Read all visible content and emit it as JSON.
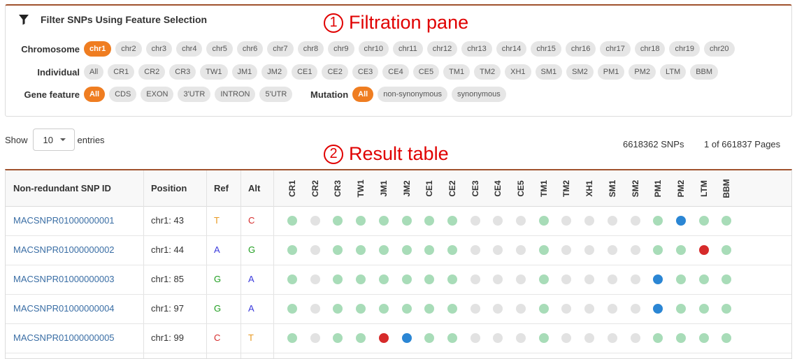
{
  "filter": {
    "title": "Filter SNPs Using Feature Selection",
    "chromosome": {
      "label": "Chromosome",
      "options": [
        "chr1",
        "chr2",
        "chr3",
        "chr4",
        "chr5",
        "chr6",
        "chr7",
        "chr8",
        "chr9",
        "chr10",
        "chr11",
        "chr12",
        "chr13",
        "chr14",
        "chr15",
        "chr16",
        "chr17",
        "chr18",
        "chr19",
        "chr20"
      ],
      "selected": "chr1"
    },
    "individual": {
      "label": "Individual",
      "options": [
        "All",
        "CR1",
        "CR2",
        "CR3",
        "TW1",
        "JM1",
        "JM2",
        "CE1",
        "CE2",
        "CE3",
        "CE4",
        "CE5",
        "TM1",
        "TM2",
        "XH1",
        "SM1",
        "SM2",
        "PM1",
        "PM2",
        "LTM",
        "BBM"
      ],
      "selected": null
    },
    "gene_feature": {
      "label": "Gene feature",
      "options": [
        "All",
        "CDS",
        "EXON",
        "3'UTR",
        "INTRON",
        "5'UTR"
      ],
      "selected": "All"
    },
    "mutation": {
      "label": "Mutation",
      "options": [
        "All",
        "non-synonymous",
        "synonymous"
      ],
      "selected": "All"
    }
  },
  "annotations": {
    "filtration": {
      "number": "1",
      "text": "Filtration pane"
    },
    "result": {
      "number": "2",
      "text": "Result table"
    }
  },
  "entries": {
    "show_label": "Show",
    "value": "10",
    "suffix": "entries"
  },
  "stats": {
    "snps": "6618362 SNPs",
    "pages": "1 of 661837 Pages"
  },
  "table": {
    "headers": {
      "id": "Non-redundant SNP ID",
      "position": "Position",
      "ref": "Ref",
      "alt": "Alt"
    },
    "individuals": [
      "CR1",
      "CR2",
      "CR3",
      "TW1",
      "JM1",
      "JM2",
      "CE1",
      "CE2",
      "CE3",
      "CE4",
      "CE5",
      "TM1",
      "TM2",
      "XH1",
      "SM1",
      "SM2",
      "PM1",
      "PM2",
      "LTM",
      "BBM"
    ],
    "rows": [
      {
        "id": "MACSNPR01000000001",
        "position": "chr1: 43",
        "ref": "T",
        "alt": "C",
        "genotypes": [
          "g",
          "x",
          "g",
          "g",
          "g",
          "g",
          "g",
          "g",
          "x",
          "x",
          "x",
          "g",
          "x",
          "x",
          "x",
          "x",
          "g",
          "b",
          "g",
          "g"
        ]
      },
      {
        "id": "MACSNPR01000000002",
        "position": "chr1: 44",
        "ref": "A",
        "alt": "G",
        "genotypes": [
          "g",
          "x",
          "g",
          "g",
          "g",
          "g",
          "g",
          "g",
          "x",
          "x",
          "x",
          "g",
          "x",
          "x",
          "x",
          "x",
          "g",
          "g",
          "r",
          "g"
        ]
      },
      {
        "id": "MACSNPR01000000003",
        "position": "chr1: 85",
        "ref": "G",
        "alt": "A",
        "genotypes": [
          "g",
          "x",
          "g",
          "g",
          "g",
          "g",
          "g",
          "g",
          "x",
          "x",
          "x",
          "g",
          "x",
          "x",
          "x",
          "x",
          "b",
          "g",
          "g",
          "g"
        ]
      },
      {
        "id": "MACSNPR01000000004",
        "position": "chr1: 97",
        "ref": "G",
        "alt": "A",
        "genotypes": [
          "g",
          "x",
          "g",
          "g",
          "g",
          "g",
          "g",
          "g",
          "x",
          "x",
          "x",
          "g",
          "x",
          "x",
          "x",
          "x",
          "b",
          "g",
          "g",
          "g"
        ]
      },
      {
        "id": "MACSNPR01000000005",
        "position": "chr1: 99",
        "ref": "C",
        "alt": "T",
        "genotypes": [
          "g",
          "x",
          "g",
          "g",
          "r",
          "b",
          "g",
          "g",
          "x",
          "x",
          "x",
          "g",
          "x",
          "x",
          "x",
          "x",
          "g",
          "g",
          "g",
          "g"
        ]
      }
    ]
  },
  "colors": {
    "accent": "#ef7d21",
    "border_top": "#a0522d",
    "link": "#3a6ea5",
    "annotation": "#e00000",
    "genotype": {
      "g": "#a8dcb8",
      "x": "#e2e2e2",
      "b": "#2b86d4",
      "r": "#d62b2b"
    },
    "base": {
      "A": "#3b3bdc",
      "C": "#d62b2b",
      "G": "#1f9e1f",
      "T": "#e89820"
    }
  },
  "icons": {
    "filter": "filter-funnel-icon",
    "select": "chevron-down-icon"
  }
}
